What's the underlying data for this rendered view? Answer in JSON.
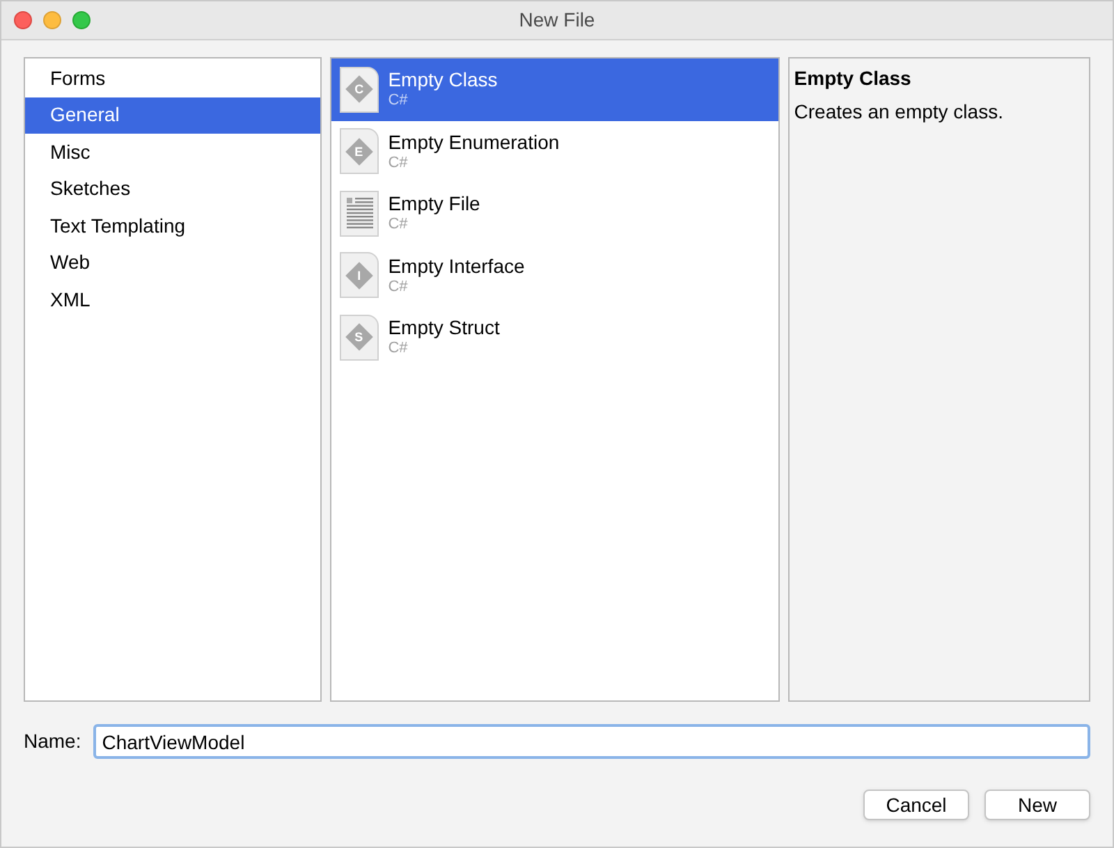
{
  "window": {
    "title": "New File"
  },
  "categories": [
    {
      "label": "Forms",
      "selected": false
    },
    {
      "label": "General",
      "selected": true
    },
    {
      "label": "Misc",
      "selected": false
    },
    {
      "label": "Sketches",
      "selected": false
    },
    {
      "label": "Text Templating",
      "selected": false
    },
    {
      "label": "Web",
      "selected": false
    },
    {
      "label": "XML",
      "selected": false
    }
  ],
  "templates": [
    {
      "name": "Empty Class",
      "language": "C#",
      "kind": "letter",
      "icon_letter": "C",
      "selected": true
    },
    {
      "name": "Empty Enumeration",
      "language": "C#",
      "kind": "letter",
      "icon_letter": "E",
      "selected": false
    },
    {
      "name": "Empty File",
      "language": "C#",
      "kind": "document",
      "selected": false
    },
    {
      "name": "Empty Interface",
      "language": "C#",
      "kind": "letter",
      "icon_letter": "I",
      "selected": false
    },
    {
      "name": "Empty Struct",
      "language": "C#",
      "kind": "letter",
      "icon_letter": "S",
      "selected": false
    }
  ],
  "description": {
    "title": "Empty Class",
    "text": "Creates an empty class."
  },
  "name_field": {
    "label": "Name:",
    "value": "ChartViewModel"
  },
  "buttons": [
    "Cancel",
    "New"
  ]
}
